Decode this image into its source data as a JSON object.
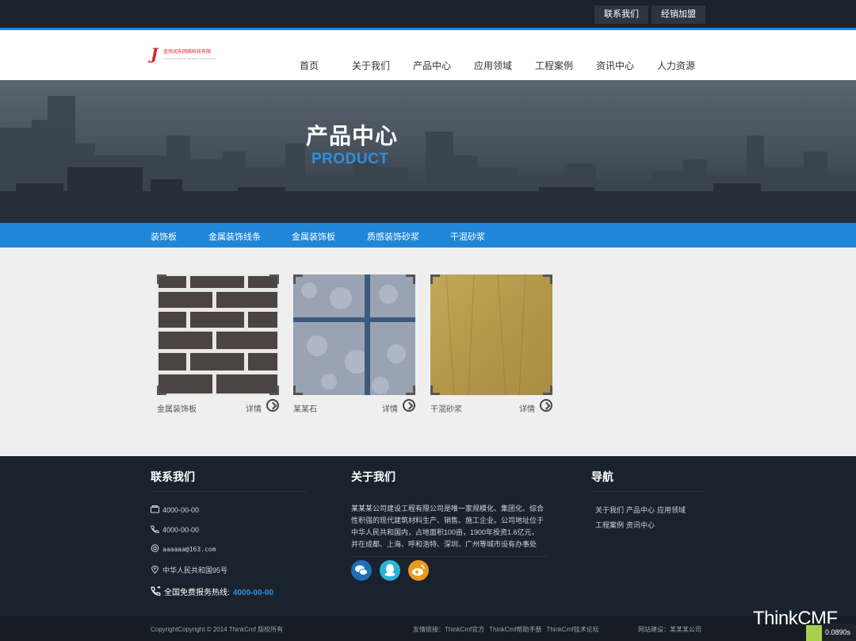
{
  "topbar": {
    "contact_label": "联系我们",
    "dealer_label": "经销加盟"
  },
  "header": {
    "logo_text_cn": "金炜润东网络科技有限",
    "logo_text_en": "JINGWEI RUNDONG NETWORK TECHNOLOGY"
  },
  "nav": {
    "items": [
      {
        "label": "首页"
      },
      {
        "label": "关于我们"
      },
      {
        "label": "产品中心"
      },
      {
        "label": "应用领域"
      },
      {
        "label": "工程案例"
      },
      {
        "label": "资讯中心"
      },
      {
        "label": "人力资源"
      }
    ]
  },
  "banner": {
    "title": "产品中心",
    "subtitle": "PRODUCT"
  },
  "categories": [
    {
      "label": "装饰板"
    },
    {
      "label": "金属装饰线条"
    },
    {
      "label": "金属装饰板"
    },
    {
      "label": "质感装饰砂浆"
    },
    {
      "label": "干混砂浆"
    }
  ],
  "products": [
    {
      "name": "金属装饰板",
      "detail": "详情"
    },
    {
      "name": "某某石",
      "detail": "详情"
    },
    {
      "name": "干混砂浆",
      "detail": "详情"
    }
  ],
  "footer": {
    "contact": {
      "title": "联系我们",
      "fax": "4000-00-00",
      "phone": "4000-00-00",
      "email": "aaaaaa@163.com",
      "address": "中华人民共和国95号",
      "hotline_label": "全国免费报务热线:",
      "hotline_value": "4000-00-00"
    },
    "about": {
      "title": "关于我们",
      "text": "某某某公司建设工程有限公司是唯一家规模化、集团化、综合性积强的现代建筑材料生产、销售、施工企业。公司地址位于中华人民共和国内，占地面积100亩，1900年投资1.6亿元，并在成都、上海、呼和浩特、深圳、广州等城市设有办事处"
    },
    "nav": {
      "title": "导航",
      "items": [
        {
          "label": "关于我们"
        },
        {
          "label": "产品中心"
        },
        {
          "label": "应用领域"
        },
        {
          "label": "工程案例"
        },
        {
          "label": "资讯中心"
        }
      ]
    }
  },
  "bottombar": {
    "copyright": "CopyrightCopyright © 2014 ThinkCmf 版权所有",
    "links_label": "友情链接：",
    "links": [
      {
        "label": "ThinkCmf官方"
      },
      {
        "label": "ThinkCmf帮助手册"
      },
      {
        "label": "ThinkCmf技术论坛"
      }
    ],
    "builder": "网站建设：某某某公司"
  },
  "overlay": {
    "brand": "ThinkCMF",
    "timer": "0.0890s"
  },
  "icons": {
    "fax": "fax-icon",
    "phone": "phone-icon",
    "email": "at-icon",
    "address": "location-pin-icon",
    "hotline": "phone-call-icon",
    "wechat": "wechat-icon",
    "qq": "qq-icon",
    "weibo": "weibo-icon"
  },
  "colors": {
    "accent": "#2086d8",
    "dark": "#1a232d",
    "wechat": "#1d6fb8",
    "qq": "#28b4d6",
    "weibo": "#ec9a1e"
  }
}
